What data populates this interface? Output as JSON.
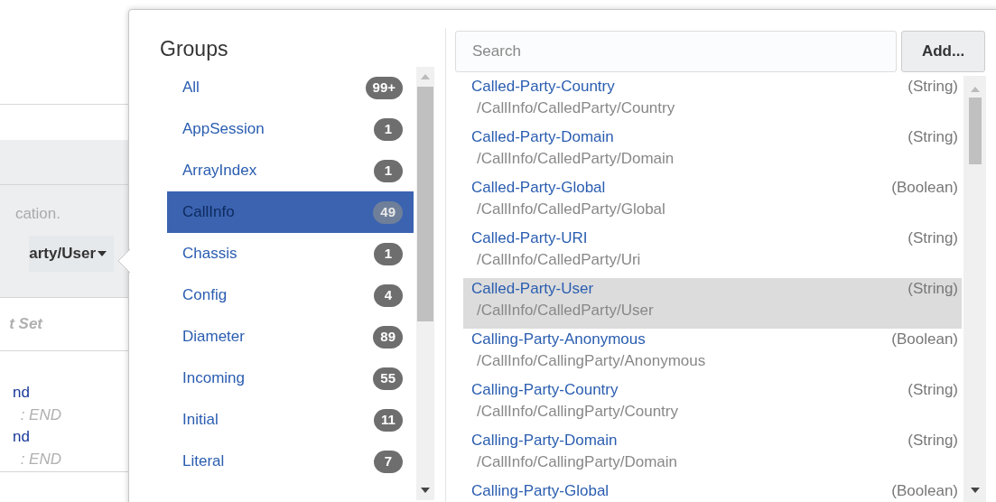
{
  "background": {
    "hint": "cation.",
    "path_button": "arty/User",
    "value": "t Set",
    "entries": [
      {
        "name": "nd",
        "detail": ": END"
      },
      {
        "name": "nd",
        "detail": ": END"
      }
    ]
  },
  "popover": {
    "groups_title": "Groups",
    "groups": [
      {
        "label": "All",
        "count": "99+",
        "selected": false
      },
      {
        "label": "AppSession",
        "count": "1",
        "selected": false
      },
      {
        "label": "ArrayIndex",
        "count": "1",
        "selected": false
      },
      {
        "label": "CallInfo",
        "count": "49",
        "selected": true
      },
      {
        "label": "Chassis",
        "count": "1",
        "selected": false
      },
      {
        "label": "Config",
        "count": "4",
        "selected": false
      },
      {
        "label": "Diameter",
        "count": "89",
        "selected": false
      },
      {
        "label": "Incoming",
        "count": "55",
        "selected": false
      },
      {
        "label": "Initial",
        "count": "11",
        "selected": false
      },
      {
        "label": "Literal",
        "count": "7",
        "selected": false
      }
    ],
    "search": {
      "placeholder": "Search"
    },
    "add_button": "Add...",
    "fields": [
      {
        "name": "Called-Party-Country",
        "path": "/CallInfo/CalledParty/Country",
        "type": "(String)",
        "selected": false
      },
      {
        "name": "Called-Party-Domain",
        "path": "/CallInfo/CalledParty/Domain",
        "type": "(String)",
        "selected": false
      },
      {
        "name": "Called-Party-Global",
        "path": "/CallInfo/CalledParty/Global",
        "type": "(Boolean)",
        "selected": false
      },
      {
        "name": "Called-Party-URI",
        "path": "/CallInfo/CalledParty/Uri",
        "type": "(String)",
        "selected": false
      },
      {
        "name": "Called-Party-User",
        "path": "/CallInfo/CalledParty/User",
        "type": "(String)",
        "selected": true
      },
      {
        "name": "Calling-Party-Anonymous",
        "path": "/CallInfo/CallingParty/Anonymous",
        "type": "(Boolean)",
        "selected": false
      },
      {
        "name": "Calling-Party-Country",
        "path": "/CallInfo/CallingParty/Country",
        "type": "(String)",
        "selected": false
      },
      {
        "name": "Calling-Party-Domain",
        "path": "/CallInfo/CallingParty/Domain",
        "type": "(String)",
        "selected": false
      },
      {
        "name": "Calling-Party-Global",
        "type": "(Boolean)",
        "selected": false
      }
    ]
  }
}
